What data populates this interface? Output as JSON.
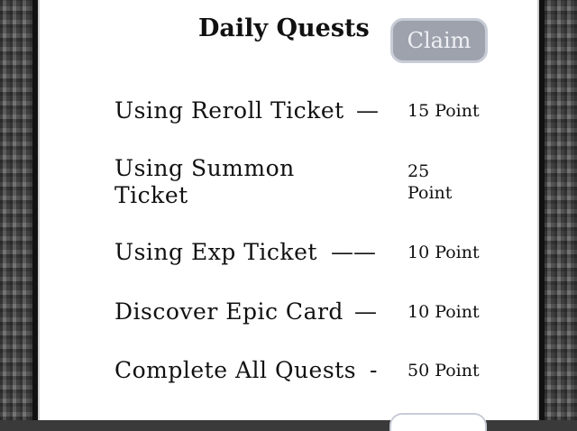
{
  "panel": {
    "title": "Daily Quests",
    "claim_label": "Claim"
  },
  "quests": [
    {
      "name": "Using Reroll Ticket",
      "dash": "—",
      "points": "15 Point"
    },
    {
      "name": "Using Summon Ticket",
      "dash": "",
      "points": "25 Point"
    },
    {
      "name": "Using Exp Ticket",
      "dash": "——",
      "points": "10 Point"
    },
    {
      "name": "Discover Epic Card",
      "dash": "—",
      "points": "10 Point"
    },
    {
      "name": "Complete All Quests",
      "dash": "-",
      "points": "50 Point"
    }
  ]
}
